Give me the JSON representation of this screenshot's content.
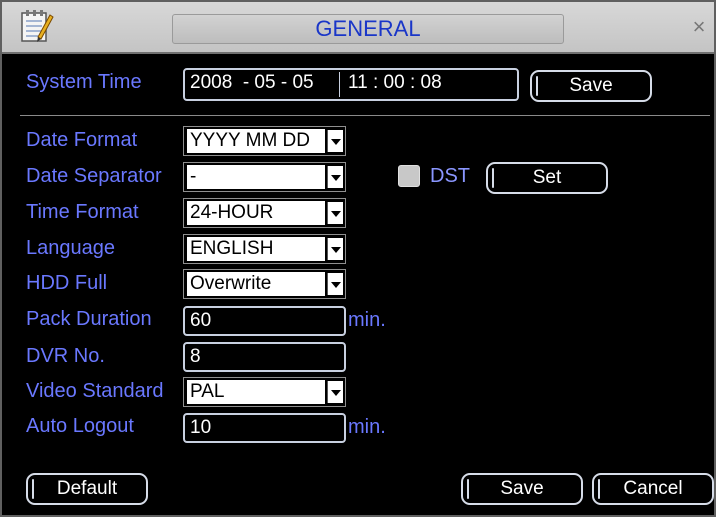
{
  "window": {
    "title": "GENERAL",
    "close_label": "×"
  },
  "system_time": {
    "label": "System Time",
    "date": "2008  - 05 - 05",
    "time": "11 : 00 : 08",
    "save_label": "Save"
  },
  "fields": {
    "date_format": {
      "label": "Date Format",
      "value": "YYYY MM DD"
    },
    "date_separator": {
      "label": "Date Separator",
      "value": "-"
    },
    "time_format": {
      "label": "Time Format",
      "value": "24-HOUR"
    },
    "language": {
      "label": "Language",
      "value": "ENGLISH"
    },
    "hdd_full": {
      "label": "HDD Full",
      "value": "Overwrite"
    },
    "pack_duration": {
      "label": "Pack Duration",
      "value": "60",
      "unit": "min."
    },
    "dvr_no": {
      "label": "DVR No.",
      "value": "8"
    },
    "video_standard": {
      "label": "Video Standard",
      "value": "PAL"
    },
    "auto_logout": {
      "label": "Auto Logout",
      "value": "10",
      "unit": "min."
    }
  },
  "dst": {
    "label": "DST",
    "checked": false,
    "set_label": "Set"
  },
  "buttons": {
    "default_label": "Default",
    "save_label": "Save",
    "cancel_label": "Cancel"
  },
  "colors": {
    "label": "#6a78ff",
    "title": "#1a36c8",
    "background": "#000000"
  }
}
